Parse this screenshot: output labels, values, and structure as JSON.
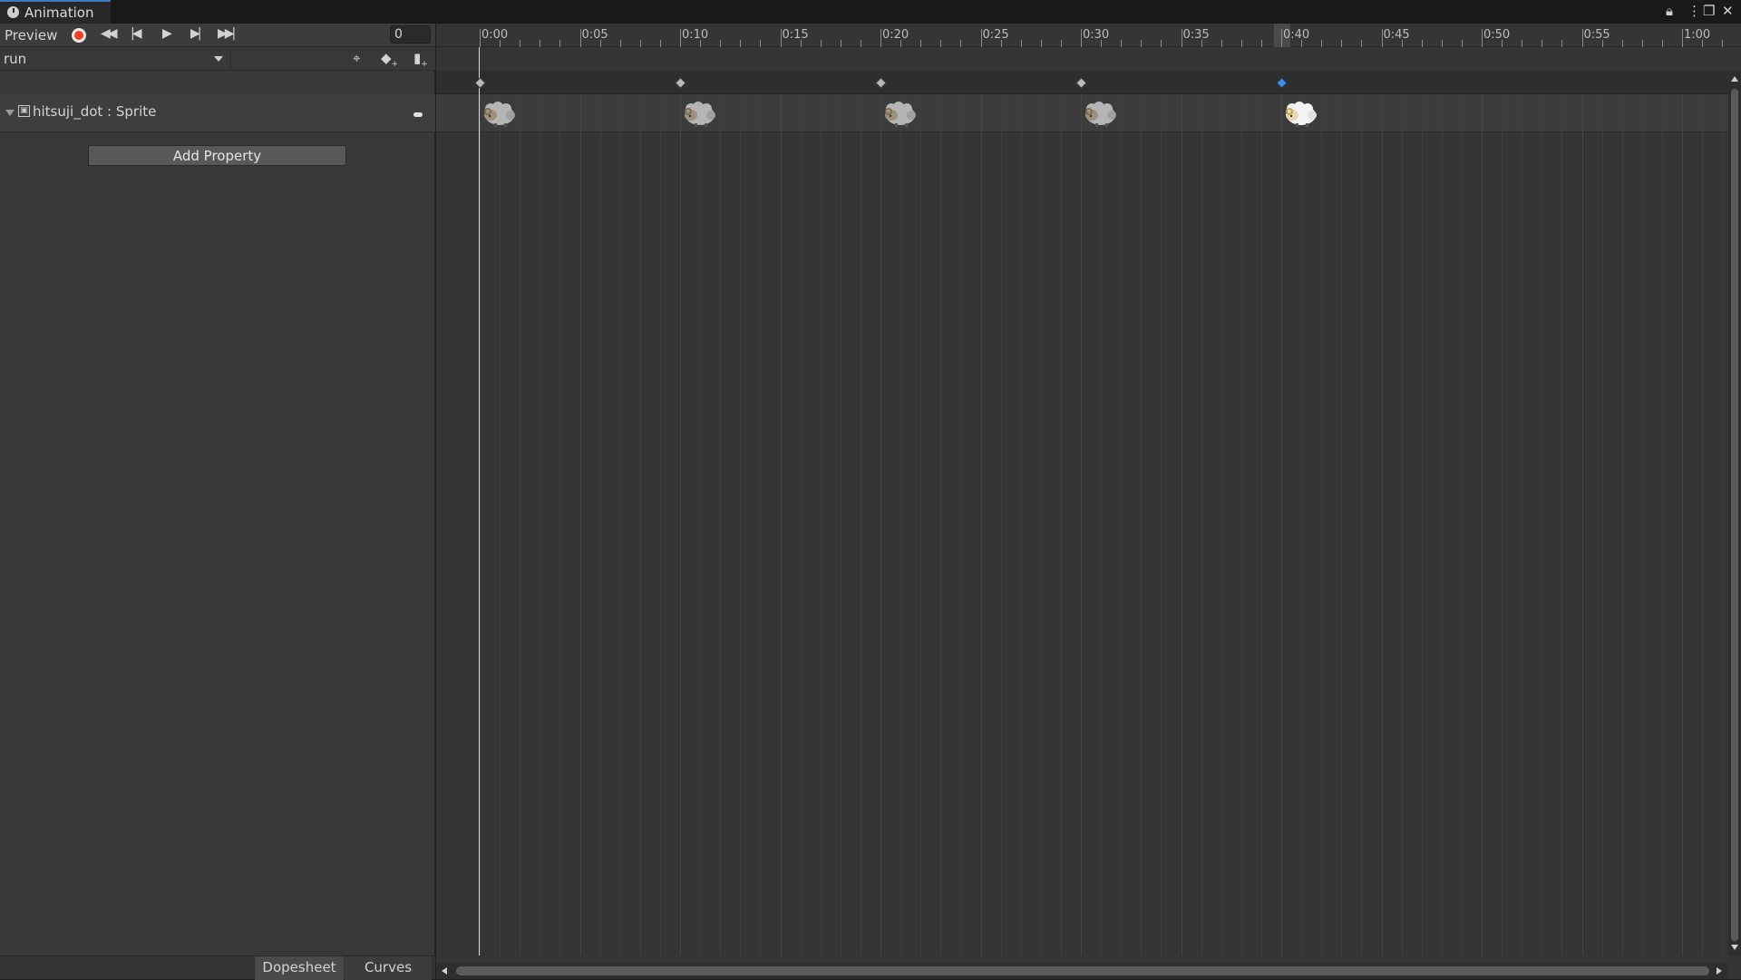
{
  "window": {
    "tab_title": "Animation",
    "tab_icon": "clock-icon",
    "controls": [
      "lock-icon",
      "kebab-menu-icon",
      "maximize-icon",
      "close-icon"
    ]
  },
  "toolbar": {
    "preview_label": "Preview",
    "frame_value": "0",
    "buttons": [
      "record-icon",
      "first-key-icon",
      "prev-key-icon",
      "play-icon",
      "next-key-icon",
      "last-key-icon"
    ],
    "record_color": "#f0401d"
  },
  "clip": {
    "selected": "run",
    "tools": [
      "filter-icon",
      "add-keyframe-icon",
      "add-event-icon"
    ]
  },
  "property": {
    "label": "hitsuji_dot : Sprite",
    "icon": "sprite-icon"
  },
  "add_property_label": "Add Property",
  "tabs": {
    "dopesheet": "Dopesheet",
    "curves": "Curves"
  },
  "timeline": {
    "labels": [
      "0:00",
      "0:05",
      "0:10",
      "0:15",
      "0:20",
      "0:25",
      "0:30",
      "0:35",
      "0:40",
      "0:45",
      "0:50",
      "0:55",
      "1:00"
    ],
    "keyframes": [
      "0:00",
      "0:10",
      "0:20",
      "0:30",
      "0:40"
    ],
    "selected_keyframe": "0:40",
    "key_color": "#b8b8b8",
    "selected_key_color": "#3d8bf0",
    "playhead": "0:00"
  }
}
